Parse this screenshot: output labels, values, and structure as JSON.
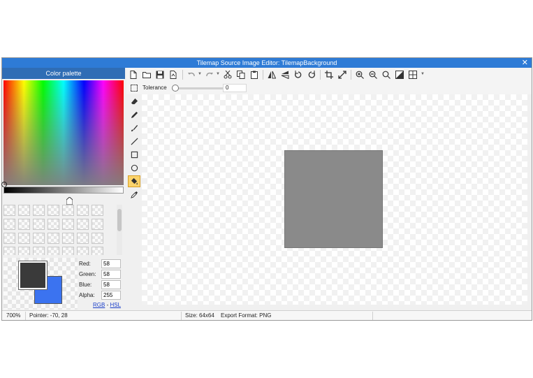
{
  "window": {
    "title": "Tilemap Source Image Editor: TilemapBackground",
    "close_glyph": "✕"
  },
  "palette": {
    "header": "Color palette",
    "foreground_color": "#3a3a3a",
    "background_color": "#3b73f0",
    "red_label": "Red:",
    "red": "58",
    "green_label": "Green:",
    "green": "58",
    "blue_label": "Blue:",
    "blue": "58",
    "alpha_label": "Alpha:",
    "alpha": "255",
    "mode_rgb": "RGB",
    "mode_sep": " - ",
    "mode_hsl": "HSL"
  },
  "toolbar": {
    "buttons": [
      "new-file-icon",
      "open-folder-icon",
      "save-icon",
      "export-icon",
      "undo-icon",
      "redo-icon",
      "cut-icon",
      "copy-icon",
      "paste-icon",
      "flip-horizontal-icon",
      "flip-vertical-icon",
      "rotate-left-icon",
      "rotate-right-icon",
      "crop-icon",
      "resize-icon",
      "zoom-in-icon",
      "zoom-out-icon",
      "zoom-reset-icon",
      "toggle-background-icon",
      "grid-icon"
    ]
  },
  "options": {
    "tolerance_label": "Tolerance",
    "tolerance_value": "0"
  },
  "tools": {
    "selected": "fill-tool"
  },
  "canvas": {
    "image_color": "#8a8a8a"
  },
  "status": {
    "zoom": "700%",
    "pointer": "Pointer: -70, 28",
    "size": "Size: 64x64",
    "export_format": "Export Format: PNG"
  }
}
